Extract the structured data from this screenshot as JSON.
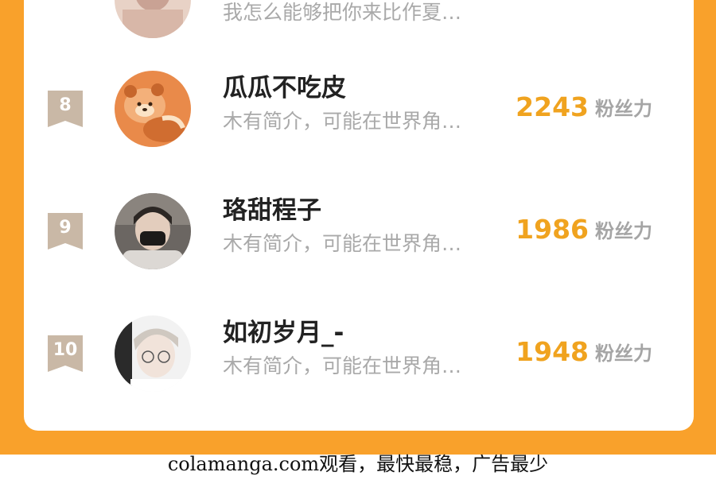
{
  "ranking": {
    "partial_top": {
      "bio": "我怎么能够把你来比作夏…"
    },
    "entries": [
      {
        "rank": "8",
        "name": "瓜瓜不吃皮",
        "bio": "木有简介，可能在世界角…",
        "score": "2243",
        "unit": "粉丝力",
        "avatar": "red-panda-avatar"
      },
      {
        "rank": "9",
        "name": "珞甜程子",
        "bio": "木有简介，可能在世界角…",
        "score": "1986",
        "unit": "粉丝力",
        "avatar": "masked-person-avatar"
      },
      {
        "rank": "10",
        "name": "如初岁月_-",
        "bio": "木有简介，可能在世界角…",
        "score": "1948",
        "unit": "粉丝力",
        "avatar": "glasses-person-avatar"
      }
    ]
  },
  "footer": {
    "text": "colamanga.com观看，最快最稳，广告最少"
  },
  "colors": {
    "frame": "#f9a12b",
    "score": "#f0a31f",
    "rank_badge": "#c9b8a6"
  }
}
